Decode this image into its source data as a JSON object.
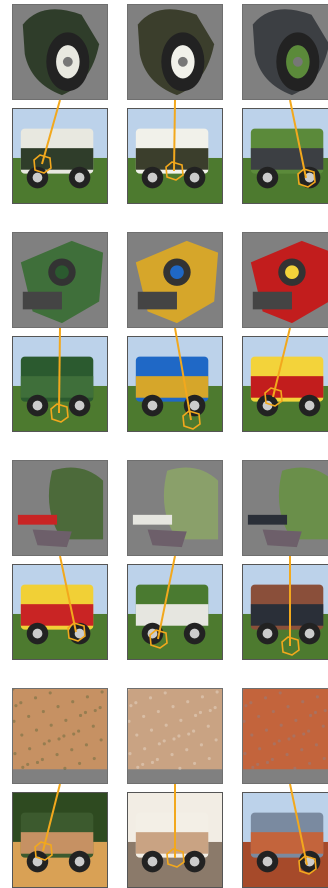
{
  "colors": {
    "link_line": "#f2a81d",
    "patch_background": "#808080",
    "sky": "#bcd2ea",
    "grass": "#4d7a2f",
    "sand": "#c86a3a"
  },
  "rows": [
    {
      "name": "wheel-matches",
      "cells": [
        {
          "patch": "tire-closeup",
          "photo": "white-landrover-on-grass",
          "palette": [
            "#2f3d2a",
            "#e8e8e0",
            "#6fa24c"
          ]
        },
        {
          "patch": "tire-closeup",
          "photo": "white-landrover-with-driver",
          "palette": [
            "#3b3e2c",
            "#f1f1ea",
            "#8fa0b7"
          ]
        },
        {
          "patch": "tire-closeup",
          "photo": "green-landrover-in-lot",
          "palette": [
            "#3c3f43",
            "#5b8a3a",
            "#7f9a6a"
          ]
        }
      ]
    },
    {
      "name": "vehicle-part-matches",
      "cells": [
        {
          "patch": "green-fender",
          "photo": "green-landrover-front",
          "palette": [
            "#3f6f3a",
            "#2b5a2f",
            "#9fb07a"
          ]
        },
        {
          "patch": "yellow-light",
          "photo": "yellow-landrover-hill",
          "palette": [
            "#d6a62a",
            "#1f68c6",
            "#a07a5a"
          ]
        },
        {
          "patch": "red-bumper",
          "photo": "red-fire-landrover",
          "palette": [
            "#c21d1d",
            "#f3d33a",
            "#999999"
          ]
        }
      ]
    },
    {
      "name": "background-matches",
      "cells": [
        {
          "patch": "tree-and-red",
          "photo": "red-fire-landrover-2",
          "palette": [
            "#c92424",
            "#f1d036",
            "#4c6a3a"
          ]
        },
        {
          "patch": "grey-foliage",
          "photo": "white-landrover-field",
          "palette": [
            "#e6e6e0",
            "#4a7a30",
            "#8aa06a"
          ]
        },
        {
          "patch": "tree-foliage",
          "photo": "dark-suvs-street",
          "palette": [
            "#2a2f38",
            "#8a4f3a",
            "#6a8f4a"
          ]
        }
      ]
    },
    {
      "name": "ground-texture-matches",
      "cells": [
        {
          "patch": "soil-texture",
          "photo": "green-landrover-autumn",
          "palette": [
            "#c69163",
            "#3c5a2e",
            "#d9a155"
          ]
        },
        {
          "patch": "sand-texture",
          "photo": "white-landrover-studio",
          "palette": [
            "#c9a383",
            "#f3efe6",
            "#8b7a6a"
          ]
        },
        {
          "patch": "red-sand-texture",
          "photo": "desert-red-ground",
          "palette": [
            "#c3643c",
            "#7a8aa0",
            "#a64a2a"
          ]
        }
      ]
    }
  ]
}
